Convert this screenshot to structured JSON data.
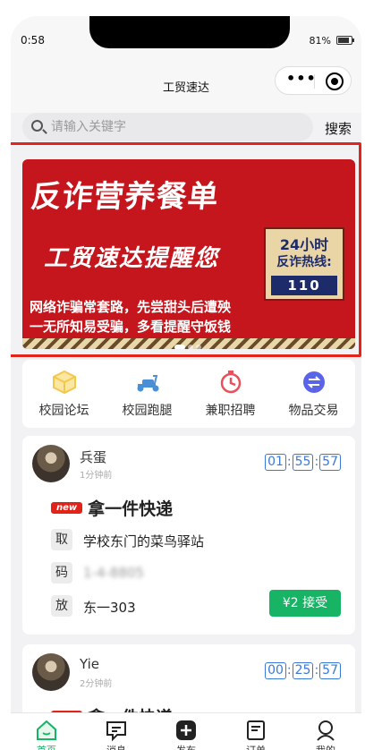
{
  "status": {
    "time": "0:58",
    "battery": "81%"
  },
  "nav": {
    "title": "工贸速达"
  },
  "search": {
    "placeholder": "请输入关键字",
    "button": "搜索"
  },
  "banner": {
    "title": "反诈营养餐单",
    "subtitle": "工贸速达提醒您",
    "hotline_1": "24小时",
    "hotline_2": "反诈热线:",
    "hotline_number": "110",
    "line1": "网络诈骗常套路，先尝甜头后遭殃",
    "line2": "一无所知易受骗，多看提醒守饭钱"
  },
  "categories": [
    {
      "label": "校园论坛",
      "icon": "forum-box-icon",
      "color": "#f2c84b"
    },
    {
      "label": "校园跑腿",
      "icon": "scooter-icon",
      "color": "#4a8fd6"
    },
    {
      "label": "兼职招聘",
      "icon": "timer-icon",
      "color": "#e8505b"
    },
    {
      "label": "物品交易",
      "icon": "exchange-icon",
      "color": "#5b63e6"
    }
  ],
  "orders": [
    {
      "user": "兵蛋",
      "time_ago": "1分钟前",
      "countdown": [
        "01",
        "55",
        "57"
      ],
      "badge": "new",
      "title": "拿一件快递",
      "pickup_tag": "取",
      "pickup": "学校东门的菜鸟驿站",
      "code_tag": "码",
      "code": "1-4-8805",
      "dropoff_tag": "放",
      "dropoff": "东一303",
      "accept_label": "¥2 接受"
    },
    {
      "user": "Yie",
      "time_ago": "2分钟前",
      "countdown": [
        "00",
        "25",
        "57"
      ],
      "badge": "new",
      "title": "拿一件快递"
    }
  ],
  "tabs": [
    {
      "label": "首页",
      "icon": "home-icon",
      "active": true
    },
    {
      "label": "消息",
      "icon": "message-icon"
    },
    {
      "label": "发布",
      "icon": "add-icon"
    },
    {
      "label": "订单",
      "icon": "order-icon"
    },
    {
      "label": "我的",
      "icon": "profile-icon"
    }
  ],
  "colors": {
    "accent": "#18b466",
    "timer": "#3a79d8",
    "badge": "#e2231a",
    "banner": "#c4161c"
  }
}
